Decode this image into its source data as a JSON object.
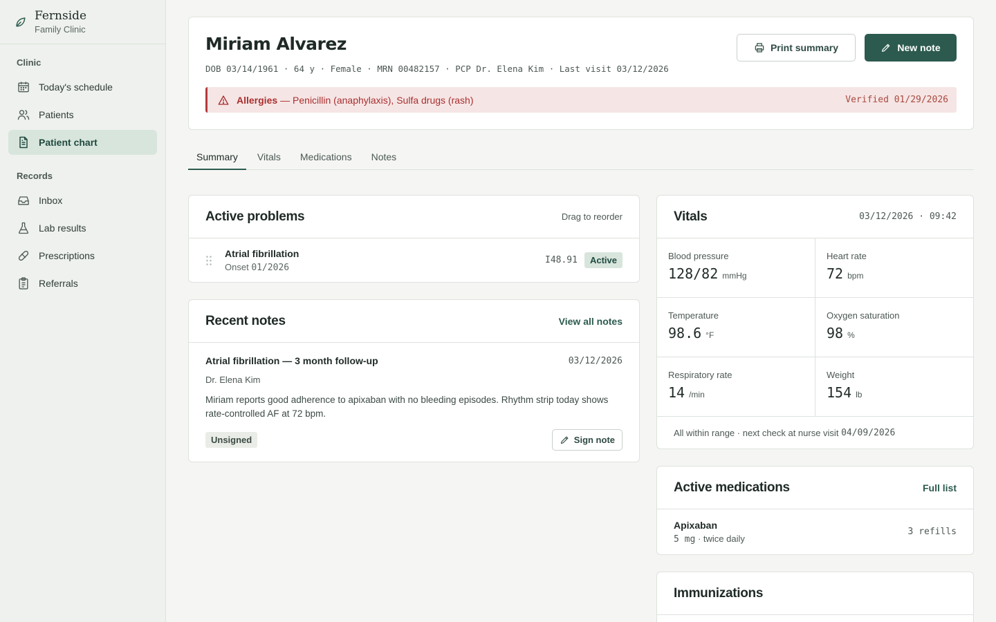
{
  "brand": {
    "name": "Fernside",
    "subtitle": "Family Clinic"
  },
  "sidebar": {
    "sections": [
      {
        "heading": "Clinic",
        "items": [
          {
            "label": "Today's schedule",
            "icon": "calendar-icon"
          },
          {
            "label": "Patients",
            "icon": "users-icon"
          },
          {
            "label": "Patient chart",
            "icon": "file-text-icon",
            "active": true
          }
        ]
      },
      {
        "heading": "Records",
        "items": [
          {
            "label": "Inbox",
            "icon": "inbox-icon"
          },
          {
            "label": "Lab results",
            "icon": "flask-icon"
          },
          {
            "label": "Prescriptions",
            "icon": "pill-icon"
          },
          {
            "label": "Referrals",
            "icon": "clipboard-icon"
          }
        ]
      }
    ]
  },
  "patient": {
    "name": "Miriam Alvarez",
    "meta": "DOB 03/14/1961 · 64 y · Female · MRN 00482157 · PCP Dr. Elena Kim · Last visit 03/12/2026",
    "print_label": "Print summary",
    "new_note_label": "New note",
    "allergy": {
      "label": "Allergies",
      "text": "— Penicillin (anaphylaxis), Sulfa drugs (rash)",
      "verified": "Verified 01/29/2026"
    }
  },
  "tabs": [
    "Summary",
    "Vitals",
    "Medications",
    "Notes"
  ],
  "problems": {
    "title": "Active problems",
    "action": "Drag to reorder",
    "items": [
      {
        "name": "Atrial fibrillation",
        "onset_label": "Onset",
        "onset": "01/2026",
        "code": "I48.91",
        "status": "Active"
      }
    ]
  },
  "notes": {
    "title": "Recent notes",
    "action": "View all notes",
    "items": [
      {
        "title": "Atrial fibrillation — 3 month follow-up",
        "date": "03/12/2026",
        "author": "Dr. Elena Kim",
        "text": "Miriam reports good adherence to apixaban with no bleeding episodes. Rhythm strip today shows rate-controlled AF at 72 bpm.",
        "status": "Unsigned",
        "sign_label": "Sign note"
      }
    ]
  },
  "vitals": {
    "title": "Vitals",
    "timestamp": "03/12/2026 · 09:42",
    "items": [
      {
        "label": "Blood pressure",
        "value": "128/82",
        "unit": "mmHg"
      },
      {
        "label": "Heart rate",
        "value": "72",
        "unit": "bpm"
      },
      {
        "label": "Temperature",
        "value": "98.6",
        "unit": "°F"
      },
      {
        "label": "Oxygen saturation",
        "value": "98",
        "unit": "%"
      },
      {
        "label": "Respiratory rate",
        "value": "14",
        "unit": "/min"
      },
      {
        "label": "Weight",
        "value": "154",
        "unit": "lb"
      }
    ],
    "footer_text": "All within range · next check at nurse visit",
    "footer_date": "04/09/2026"
  },
  "medications": {
    "title": "Active medications",
    "action": "Full list",
    "items": [
      {
        "name": "Apixaban",
        "dose": "5 mg",
        "freq": "· twice daily",
        "refills": "3 refills"
      }
    ]
  },
  "immunizations": {
    "title": "Immunizations"
  },
  "colors": {
    "accent": "#2c5a4e",
    "alert": "#a82f2f",
    "sidebar_bg": "#eef1ed",
    "page_bg": "#f5f6f3"
  }
}
